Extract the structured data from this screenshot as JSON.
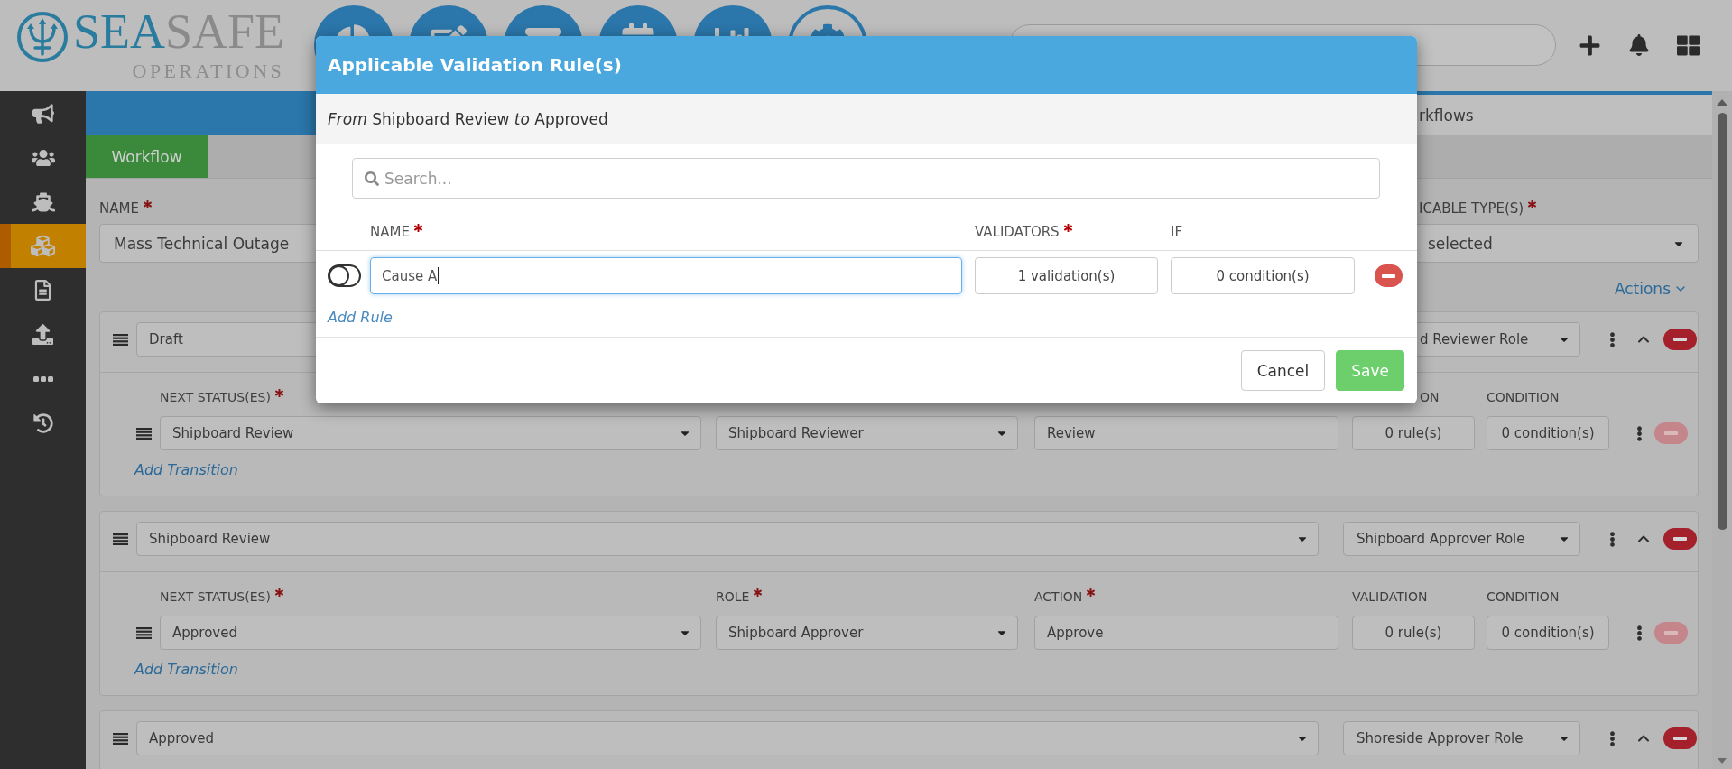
{
  "header": {
    "logo": {
      "wordmark": [
        {
          "text": "SEA",
          "kind": "accent"
        },
        {
          "text": "SAFE",
          "kind": "plain"
        }
      ],
      "tagline": "OPERATIONS"
    },
    "nav_buttons": [
      {
        "selected": false
      },
      {
        "selected": false
      },
      {
        "selected": false
      },
      {
        "selected": false
      },
      {
        "selected": false
      },
      {
        "selected": true
      }
    ]
  },
  "sidebar": {
    "items": [
      {
        "selected": false
      },
      {
        "selected": false
      },
      {
        "selected": false
      },
      {
        "selected": true
      },
      {
        "selected": false
      },
      {
        "selected": false
      },
      {
        "selected": false
      },
      {
        "selected": false
      }
    ]
  },
  "tabs": [
    {
      "selected": true
    },
    {
      "label": "rkflows",
      "selected": false
    }
  ],
  "subtabs": [
    {
      "label": "Workflow",
      "selected": true
    }
  ],
  "form": {
    "name": {
      "label": "NAME",
      "required": true,
      "value": "Mass Technical Outage"
    },
    "types": {
      "label": "ICABLE TYPE(S)",
      "required": true,
      "value": "selected"
    },
    "actions_link": "Actions",
    "stages": [
      {
        "status": "Draft",
        "role": "d Reviewer Role",
        "expanded": true,
        "columns": [
          {
            "kind": "next_status",
            "label": "NEXT STATUS(ES)",
            "required": true
          },
          {
            "kind": "validation",
            "label": "ON",
            "required": false
          },
          {
            "kind": "condition",
            "label": "CONDITION",
            "required": false
          }
        ],
        "transitions": [
          {
            "next_status": "Shipboard Review",
            "role": "Shipboard Reviewer",
            "action": "Review",
            "validation": "0 rule(s)",
            "condition": "0 condition(s)",
            "remove_disabled": true
          }
        ],
        "add_transition": "Add Transition"
      },
      {
        "status": "Shipboard Review",
        "role": "Shipboard Approver Role",
        "expanded": true,
        "columns": [
          {
            "kind": "next_status",
            "label": "NEXT STATUS(ES)",
            "required": true
          },
          {
            "kind": "role",
            "label": "ROLE",
            "required": true
          },
          {
            "kind": "action",
            "label": "ACTION",
            "required": true
          },
          {
            "kind": "validation",
            "label": "VALIDATION",
            "required": false
          },
          {
            "kind": "condition",
            "label": "CONDITION",
            "required": false
          }
        ],
        "transitions": [
          {
            "next_status": "Approved",
            "role": "Shipboard Approver",
            "action": "Approve",
            "validation": "0 rule(s)",
            "condition": "0 condition(s)",
            "remove_disabled": true
          }
        ],
        "add_transition": "Add Transition"
      },
      {
        "status": "Approved",
        "role": "Shoreside Approver Role",
        "expanded": true
      }
    ]
  },
  "modal": {
    "title": "Applicable Validation Rule(s)",
    "route": "*From* Shipboard Review *to* Approved",
    "search": {
      "placeholder": "Search..."
    },
    "columns": [
      {
        "label": "NAME",
        "required": true
      },
      {
        "label": "VALIDATORS",
        "required": true
      },
      {
        "label": "IF",
        "required": false
      }
    ],
    "rules": [
      {
        "enabled": false,
        "name": "Cause A",
        "focused": true,
        "validators": "1 validation(s)",
        "conditions": "0 condition(s)"
      }
    ],
    "add_rule": "Add Rule",
    "buttons": [
      {
        "label": "Cancel",
        "kind": "default"
      },
      {
        "label": "Save",
        "kind": "primary"
      }
    ]
  }
}
